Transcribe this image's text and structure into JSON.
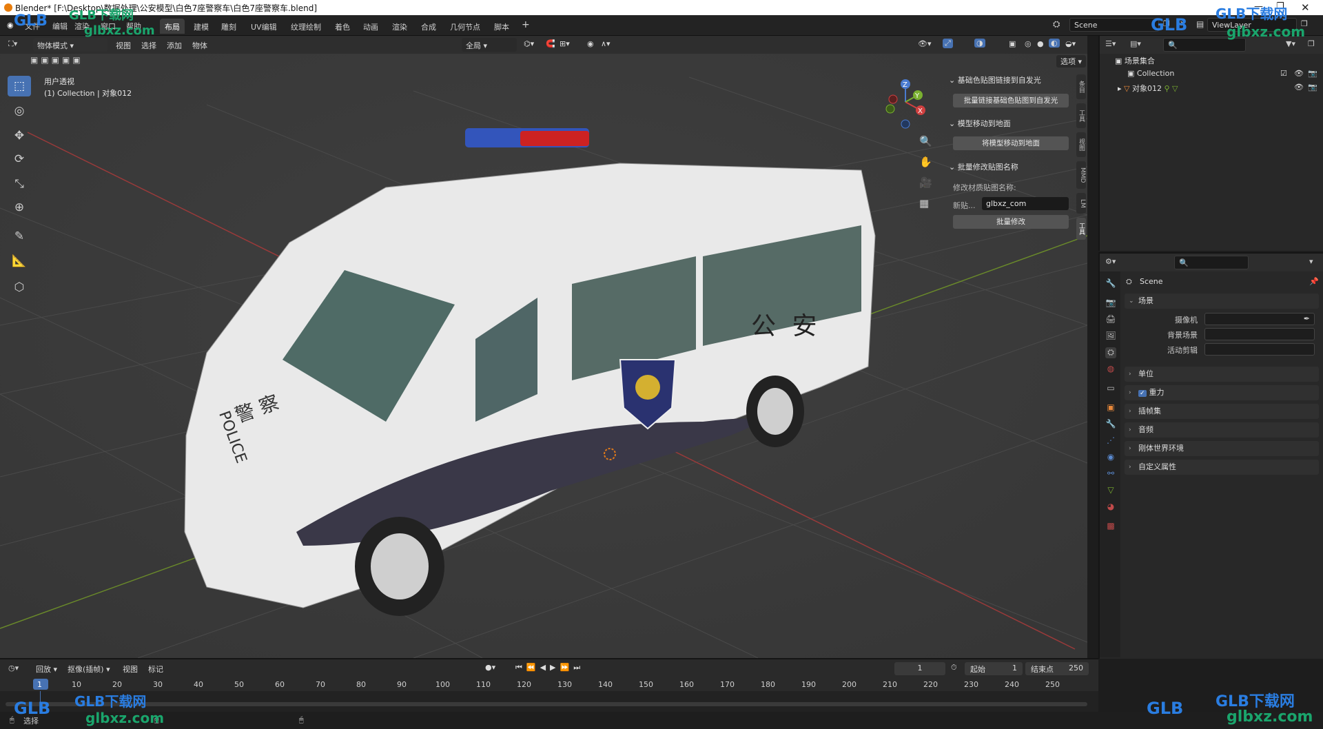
{
  "window": {
    "title": "Blender* [F:\\Desktop\\数据处理\\公安模型\\白色7座警察车\\白色7座警察车.blend]"
  },
  "menubar": {
    "items": [
      "文件",
      "编辑",
      "渲染",
      "窗口",
      "帮助"
    ],
    "workspaces": [
      "布局",
      "建模",
      "雕刻",
      "UV编辑",
      "纹理绘制",
      "着色",
      "动画",
      "渲染",
      "合成",
      "几何节点",
      "脚本"
    ],
    "active_workspace": "布局",
    "add_tab": "+",
    "scene_label": "Scene",
    "view_layer_label": "ViewLayer"
  },
  "viewport_header": {
    "mode": "物体模式",
    "menus": [
      "视图",
      "选择",
      "添加",
      "物体"
    ],
    "transform_orientation": "全局",
    "options": "选项"
  },
  "viewport": {
    "view_name": "用户透视",
    "collection_info": "(1) Collection | 对象012",
    "car_side_text": "公 安",
    "car_front_text_1": "警 察",
    "car_front_text_2": "POLICE"
  },
  "npanel": {
    "sections": [
      {
        "header": "基础色贴图链接到自发光",
        "button": "批量链接基础色贴图到自发光"
      },
      {
        "header": "模型移动到地面",
        "button": "将模型移动到地面"
      },
      {
        "header": "批量修改贴图名称",
        "label": "修改材质贴图名称:",
        "field_label": "新贴...",
        "field_value": "glbxz_com",
        "button": "批量修改"
      }
    ],
    "vertical_tabs": [
      "条目",
      "工具",
      "视图",
      "MMD",
      "LM",
      "工具"
    ]
  },
  "outliner": {
    "root": "场景集合",
    "items": [
      {
        "name": "Collection"
      },
      {
        "name": "对象012"
      }
    ]
  },
  "properties": {
    "scene_name": "Scene",
    "panel_title": "场景",
    "fields": [
      {
        "label": "摄像机"
      },
      {
        "label": "背景场景"
      },
      {
        "label": "活动剪辑"
      }
    ],
    "sections": [
      "单位",
      "重力",
      "插帧集",
      "音频",
      "刚体世界环境",
      "自定义属性"
    ]
  },
  "timeline": {
    "menus": [
      "回放",
      "抠像(插帧)",
      "视图",
      "标记"
    ],
    "current_frame": "1",
    "start_label": "起始",
    "start_value": "1",
    "end_label": "结束点",
    "end_value": "250",
    "ticks": [
      "1",
      "10",
      "20",
      "30",
      "40",
      "50",
      "60",
      "70",
      "80",
      "90",
      "100",
      "110",
      "120",
      "130",
      "140",
      "150",
      "160",
      "170",
      "180",
      "190",
      "200",
      "210",
      "220",
      "230",
      "240",
      "250"
    ]
  },
  "statusbar": {
    "left": "选择"
  },
  "watermark": {
    "brand": "GLB下载网",
    "url": "glbxz.com"
  }
}
